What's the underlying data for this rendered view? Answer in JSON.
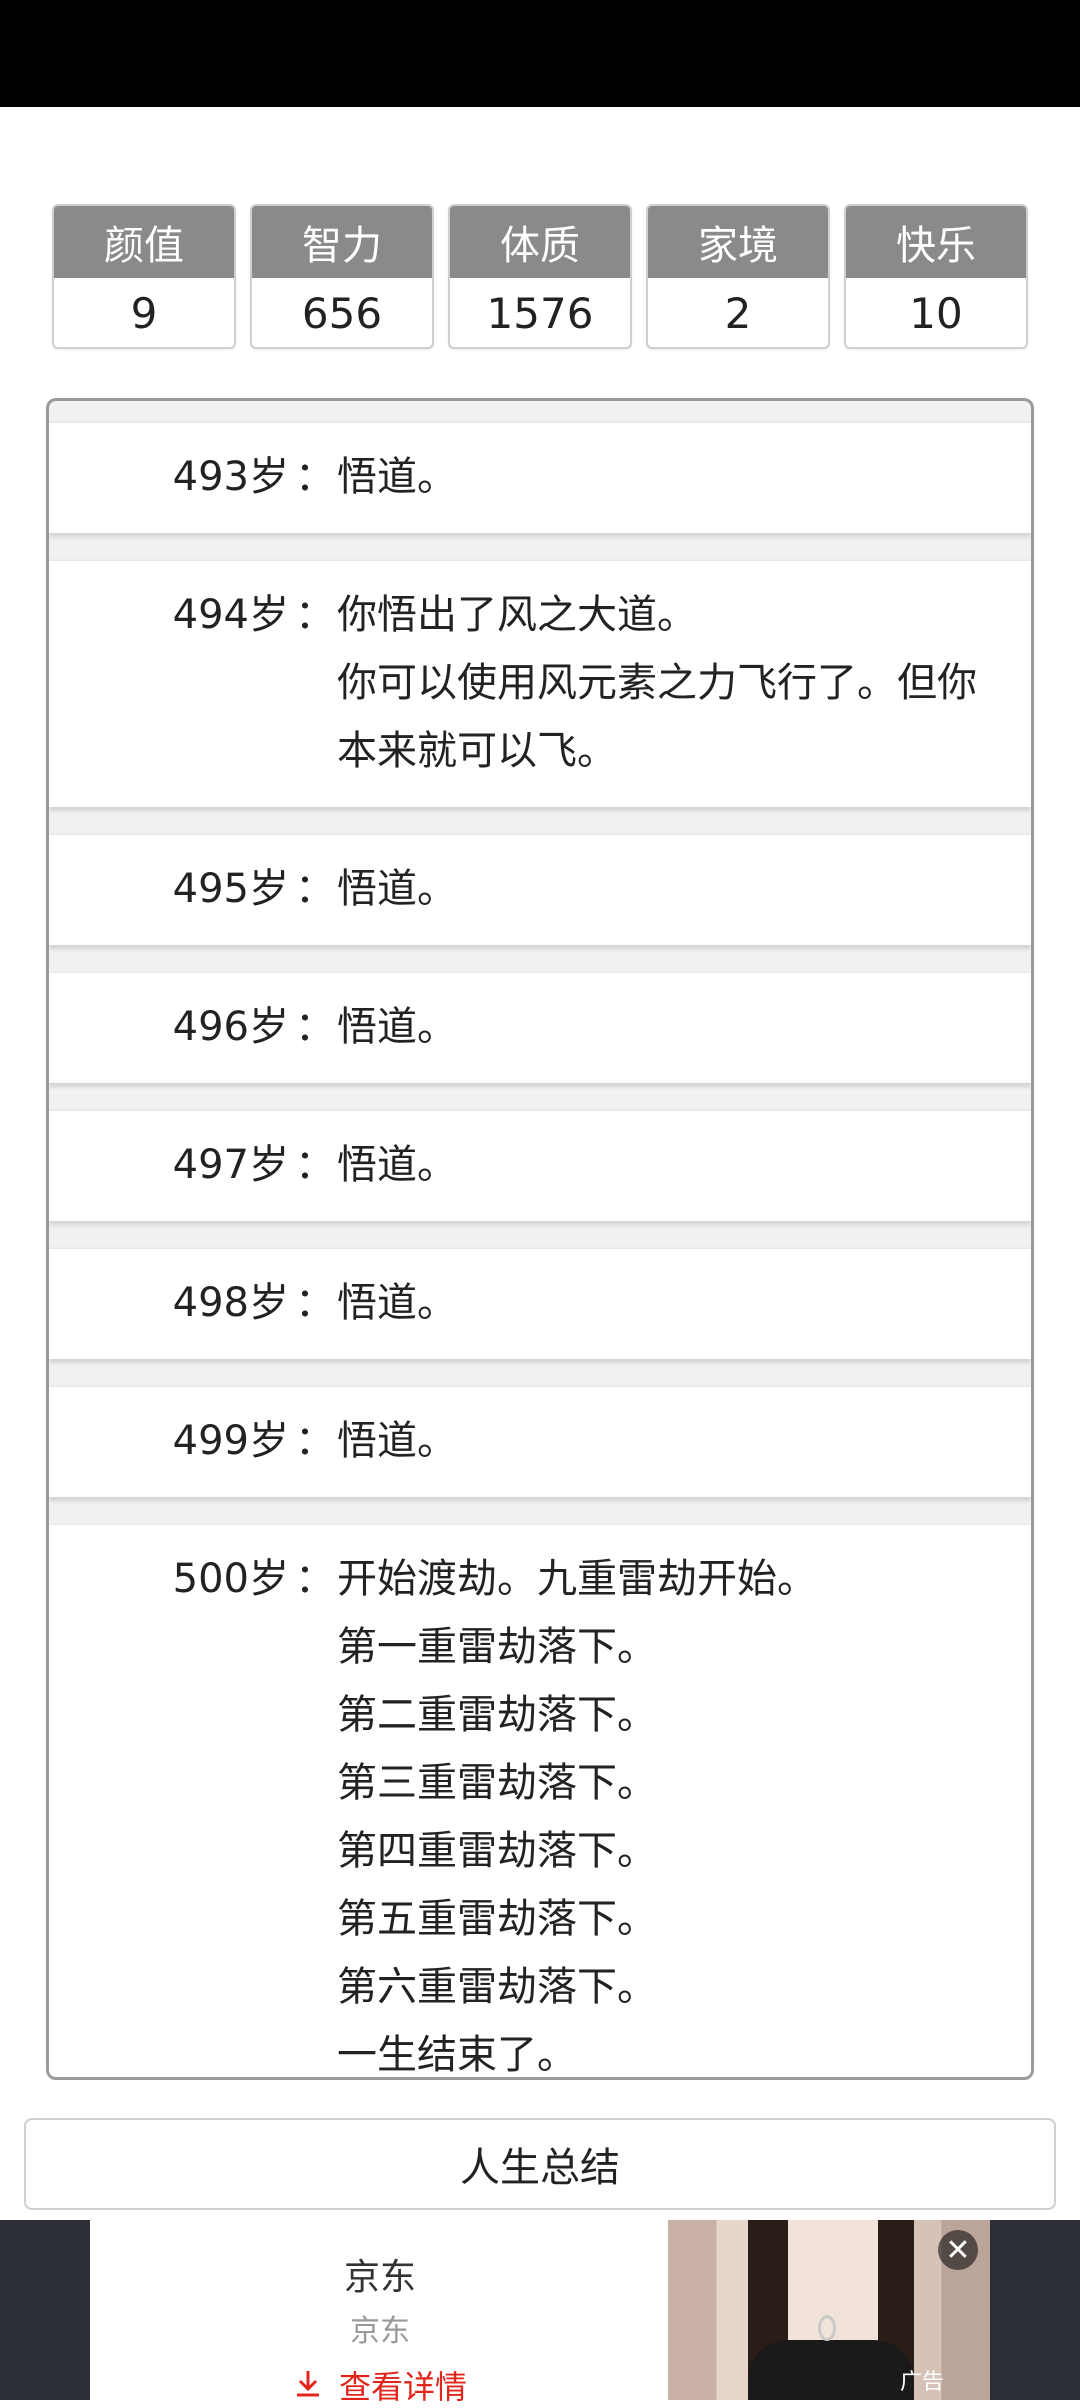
{
  "attributes": [
    {
      "name": "颜值",
      "value": "9"
    },
    {
      "name": "智力",
      "value": "656"
    },
    {
      "name": "体质",
      "value": "1576"
    },
    {
      "name": "家境",
      "value": "2"
    },
    {
      "name": "快乐",
      "value": "10"
    }
  ],
  "log": {
    "colon": "：",
    "entries": [
      {
        "age": "493岁",
        "lines": [
          "悟道。"
        ]
      },
      {
        "age": "494岁",
        "lines": [
          "你悟出了风之大道。",
          "你可以使用风元素之力飞行了。但你",
          "本来就可以飞。"
        ]
      },
      {
        "age": "495岁",
        "lines": [
          "悟道。"
        ]
      },
      {
        "age": "496岁",
        "lines": [
          "悟道。"
        ]
      },
      {
        "age": "497岁",
        "lines": [
          "悟道。"
        ]
      },
      {
        "age": "498岁",
        "lines": [
          "悟道。"
        ]
      },
      {
        "age": "499岁",
        "lines": [
          "悟道。"
        ]
      },
      {
        "age": "500岁",
        "lines": [
          "开始渡劫。九重雷劫开始。",
          "第一重雷劫落下。",
          "第二重雷劫落下。",
          "第三重雷劫落下。",
          "第四重雷劫落下。",
          "第五重雷劫落下。",
          "第六重雷劫落下。",
          "一生结束了。"
        ]
      }
    ]
  },
  "summary_button": {
    "label": "人生总结"
  },
  "ad": {
    "title": "京东",
    "subtitle": "京东",
    "cta": "查看详情",
    "label": "广告",
    "close_icon": "close-icon",
    "download_icon": "download-icon"
  }
}
